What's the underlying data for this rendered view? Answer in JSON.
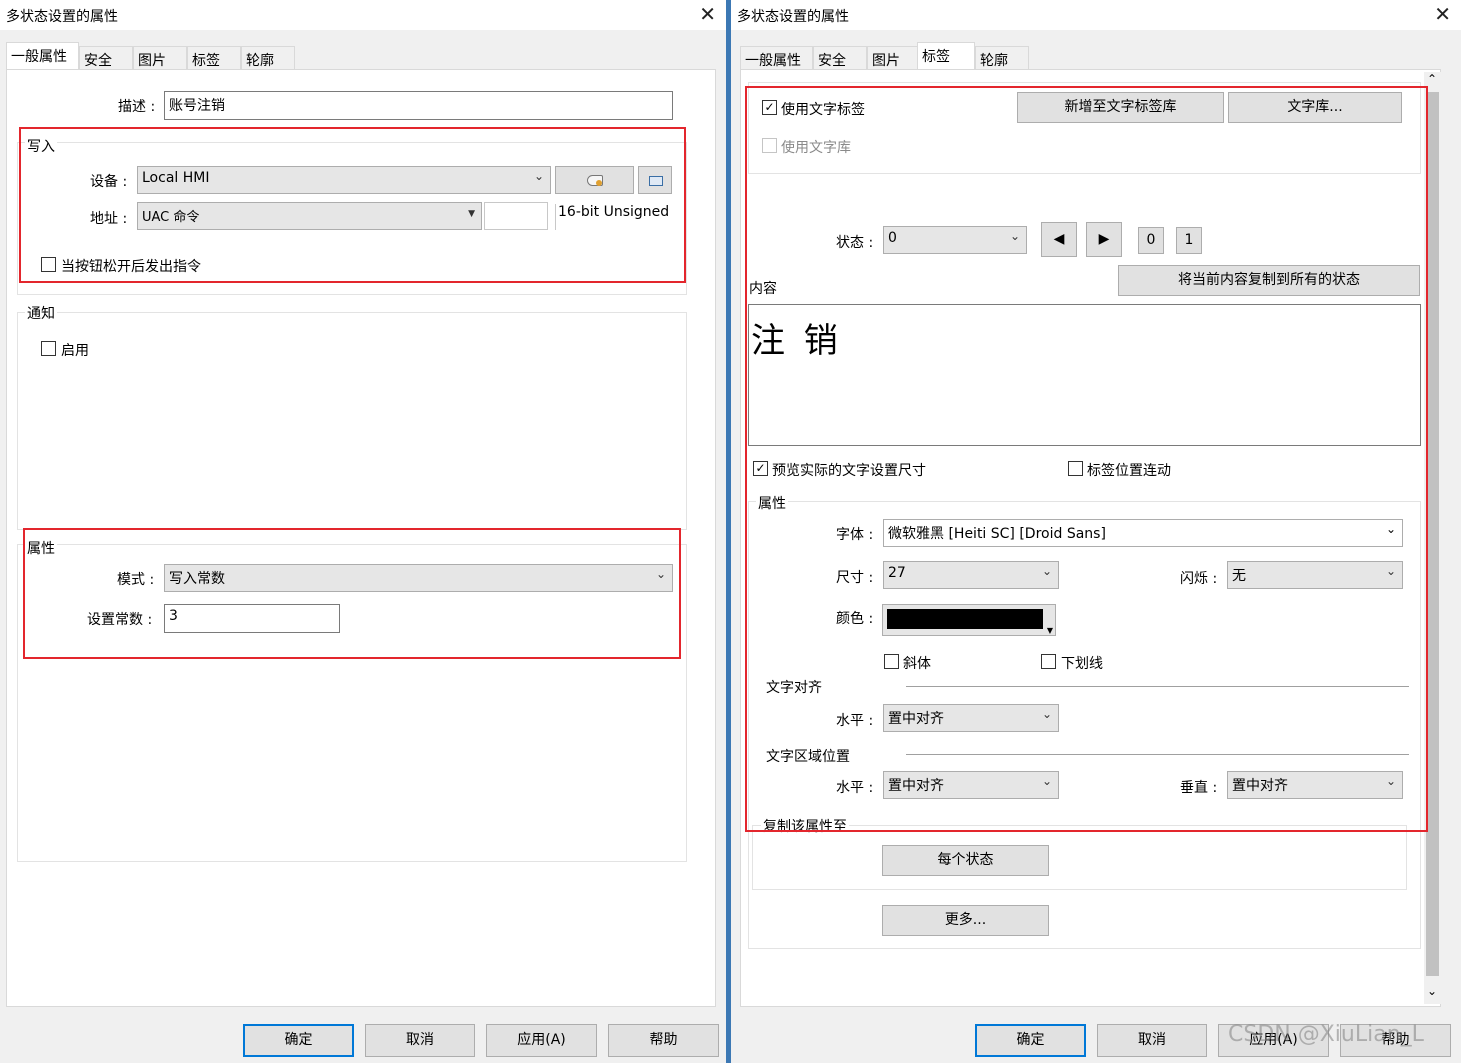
{
  "left": {
    "title": "多状态设置的属性",
    "close": "✕",
    "tabs": [
      "一般属性",
      "安全",
      "图片",
      "标签",
      "轮廓"
    ],
    "desc_label": "描述 :",
    "desc_value": "账号注销",
    "write": {
      "legend": "写入",
      "device_label": "设备 :",
      "device_value": "Local HMI",
      "address_label": "地址 :",
      "address_value": "UAC 命令",
      "address_type": "16-bit Unsigned",
      "release_label": "当按钮松开后发出指令"
    },
    "notify": {
      "legend": "通知",
      "enable_label": "启用"
    },
    "attr": {
      "legend": "属性",
      "mode_label": "模式 :",
      "mode_value": "写入常数",
      "const_label": "设置常数 :",
      "const_value": "3"
    },
    "buttons": {
      "ok": "确定",
      "cancel": "取消",
      "apply": "应用(A)",
      "help": "帮助"
    }
  },
  "right": {
    "title": "多状态设置的属性",
    "close": "✕",
    "tabs": [
      "一般属性",
      "安全",
      "图片",
      "标签",
      "轮廓"
    ],
    "use_text_label": "使用文字标签",
    "use_text_checked": true,
    "use_lib_label": "使用文字库",
    "add_lib_button": "新增至文字标签库",
    "lib_button": "文字库...",
    "state_label": "状态 :",
    "state_value": "0",
    "state_nums": [
      "0",
      "1"
    ],
    "content_label": "内容",
    "copy_all_button": "将当前内容复制到所有的状态",
    "content_text": "注 销",
    "preview_label": "预览实际的文字设置尺寸",
    "preview_checked": true,
    "linked_label": "标签位置连动",
    "attr_legend": "属性",
    "font_label": "字体 :",
    "font_value": "微软雅黑 [Heiti SC] [Droid Sans]",
    "size_label": "尺寸 :",
    "size_value": "27",
    "blink_label": "闪烁 :",
    "blink_value": "无",
    "color_label": "颜色 :",
    "color_value": "#000000",
    "italic_label": "斜体",
    "underline_label": "下划线",
    "align_legend": "文字对齐",
    "h_label": "水平 :",
    "h_align_value": "置中对齐",
    "area_legend": "文字区域位置",
    "h_area_value": "置中对齐",
    "v_label": "垂直 :",
    "v_area_value": "置中对齐",
    "copy_legend": "复制该属性至",
    "each_state_button": "每个状态",
    "more_button": "更多...",
    "buttons": {
      "ok": "确定",
      "cancel": "取消",
      "apply": "应用(A)",
      "help": "帮助"
    }
  },
  "watermark": "CSDN @XiuLian_L",
  "colors": {
    "highlight": "#e3262d",
    "accent": "#0078d7"
  }
}
